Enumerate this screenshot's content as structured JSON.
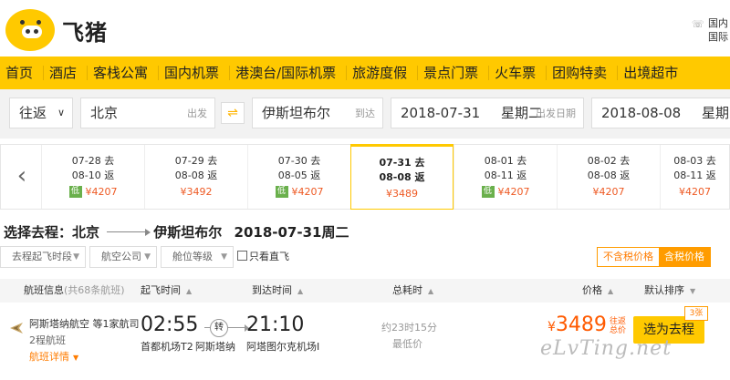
{
  "brand": {
    "name": "飞猪"
  },
  "header": {
    "hotline_lines": [
      "国内",
      "国际"
    ]
  },
  "nav": [
    "首页",
    "酒店",
    "客栈公寓",
    "国内机票",
    "港澳台/国际机票",
    "旅游度假",
    "景点门票",
    "火车票",
    "团购特卖",
    "出境超市"
  ],
  "search": {
    "trip_type": "往返",
    "from_city": "北京",
    "from_hint": "出发",
    "to_city": "伊斯坦布尔",
    "to_hint": "到达",
    "depart_date": "2018-07-31",
    "depart_weekday": "星期二",
    "depart_hint": "出发日期",
    "return_date": "2018-08-08",
    "return_weekday": "星期三"
  },
  "date_strip": [
    {
      "go": "07-28 去",
      "ret": "08-10 返",
      "low": true,
      "price": "¥4207"
    },
    {
      "go": "07-29 去",
      "ret": "08-08 返",
      "low": false,
      "price": "¥3492"
    },
    {
      "go": "07-30 去",
      "ret": "08-05 返",
      "low": true,
      "price": "¥4207"
    },
    {
      "go": "07-31 去",
      "ret": "08-08 返",
      "low": false,
      "price": "¥3489",
      "active": true
    },
    {
      "go": "08-01 去",
      "ret": "08-11 返",
      "low": true,
      "price": "¥4207"
    },
    {
      "go": "08-02 去",
      "ret": "08-08 返",
      "low": false,
      "price": "¥4207"
    },
    {
      "go": "08-03 去",
      "ret": "08-11 返",
      "low": false,
      "price": "¥4207"
    }
  ],
  "low_label": "低",
  "route": {
    "prefix": "选择去程：",
    "from": "北京",
    "to": "伊斯坦布尔",
    "date": "2018-07-31周二"
  },
  "filters": {
    "depart_time": "去程起飞时段",
    "airline": "航空公司",
    "cabin": "舱位等级",
    "direct_only": "只看直飞"
  },
  "tax_toggle": {
    "exclude": "不含税价格",
    "include": "含税价格"
  },
  "table_header": {
    "info": "航班信息",
    "info_sub": "(共68条航班)",
    "depart": "起飞时间",
    "arrive": "到达时间",
    "duration": "总耗时",
    "price": "价格",
    "sort": "默认排序"
  },
  "flight": {
    "airline": "阿斯塔纳航空 等1家航司",
    "stops": "2程航班",
    "details": "航班详情",
    "depart_time": "02:55",
    "depart_airport": "首都机场T2",
    "via_badge": "转",
    "via_city": "阿斯塔纳",
    "arrive_time": "21:10",
    "arrive_airport": "阿塔图尔克机场I",
    "duration": "约23时15分",
    "lowest": "最低价",
    "currency": "¥",
    "price": "3489",
    "price_note": "往返总价",
    "book": "选为去程",
    "seats": "3张"
  },
  "watermark": "eLvTing.net",
  "colors": {
    "brand_yellow": "#ffc900",
    "price_orange": "#ff5a00",
    "low_green": "#6ab04c"
  }
}
